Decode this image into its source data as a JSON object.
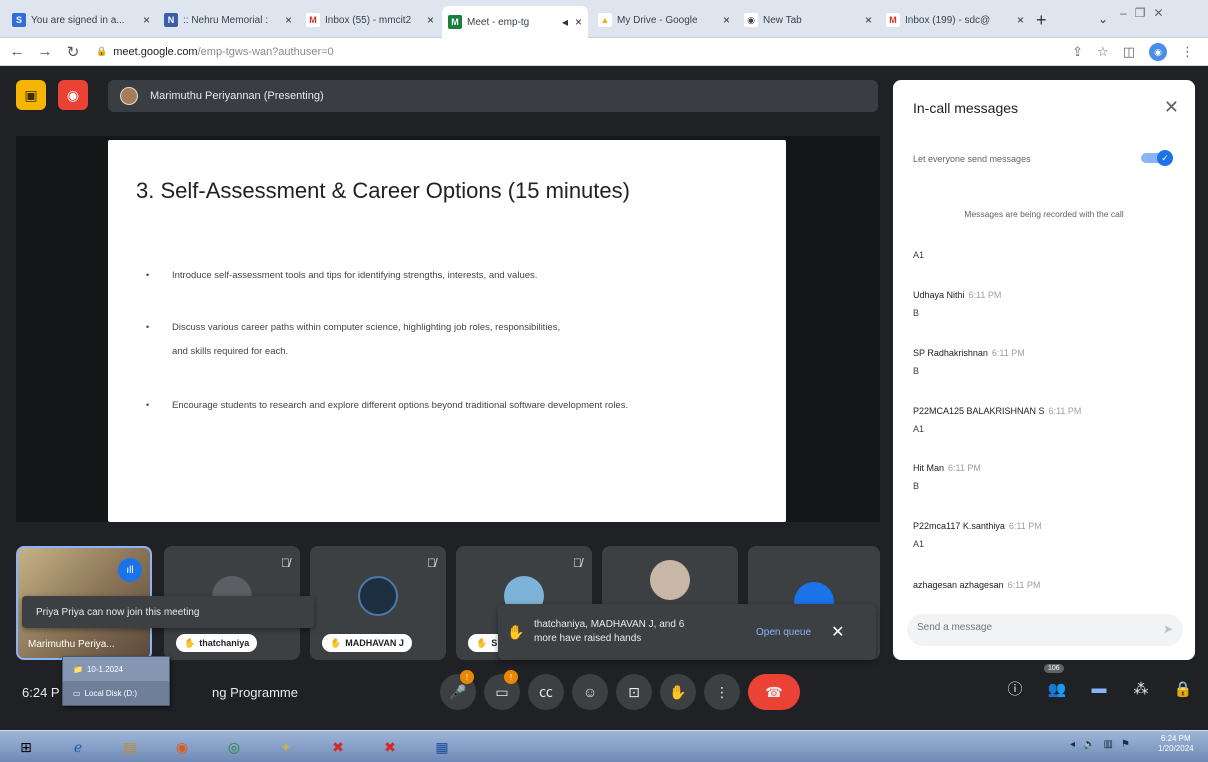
{
  "browser": {
    "tabs": [
      {
        "title": "You are signed in a...",
        "favicon": "S",
        "color": "#2f6fd6",
        "active": false
      },
      {
        "title": ":: Nehru Memorial :",
        "favicon": "N",
        "color": "#3b5ea8",
        "active": false
      },
      {
        "title": "Inbox (55) - mmcit2",
        "favicon": "M",
        "color": "#d93025",
        "active": false
      },
      {
        "title": "Meet - emp-tg",
        "favicon": "M",
        "color": "#188038",
        "active": true
      },
      {
        "title": "My Drive - Google",
        "favicon": "▲",
        "color": "#f2b400",
        "active": false
      },
      {
        "title": "New Tab",
        "favicon": "◉",
        "color": "#444444",
        "active": false
      },
      {
        "title": "Inbox (199) - sdc@",
        "favicon": "M",
        "color": "#d93025",
        "active": false
      }
    ],
    "new_tab": "+",
    "url_domain": "meet.google.com",
    "url_path": "/emp-tgws-wan?authuser=0"
  },
  "meet": {
    "presenter_label": "Marimuthu Periyannan (Presenting)",
    "slide": {
      "title": "3. Self-Assessment & Career Options (15 minutes)",
      "bullets": [
        "Introduce self-assessment tools and tips for identifying strengths, interests, and values.",
        "Discuss various career paths within computer science, highlighting job roles, responsibilities,",
        "and skills required for each.",
        "Encourage students to research and explore different options beyond traditional software development roles."
      ]
    },
    "tiles": [
      {
        "name": "Marimuthu Periya..."
      },
      {
        "name": "thatchaniya"
      },
      {
        "name": "MADHAVAN J"
      },
      {
        "name": "S"
      }
    ],
    "toast_join": "Priya Priya can now join this meeting",
    "toast_hands": {
      "line1": "thatchaniya, MADHAVAN J, and 6",
      "line2": "more have raised hands",
      "action": "Open queue"
    },
    "clock": "6:24 P",
    "title": "ng Programme",
    "participant_count": "106",
    "mic_badge": "!",
    "cam_badge": "!"
  },
  "panel": {
    "title": "In-call messages",
    "toggle_label": "Let everyone send messages",
    "recorded_note": "Messages are being recorded with the call",
    "first_message": "A1",
    "messages": [
      {
        "sender": "Udhaya Nithi",
        "time": "6:11 PM",
        "text": "B"
      },
      {
        "sender": "SP Radhakrishnan",
        "time": "6:11 PM",
        "text": "B"
      },
      {
        "sender": "P22MCA125 BALAKRISHNAN S",
        "time": "6:11 PM",
        "text": "A1"
      },
      {
        "sender": "Hit Man",
        "time": "6:11 PM",
        "text": "B"
      },
      {
        "sender": "P22mca117 K.santhiya",
        "time": "6:11 PM",
        "text": "A1"
      },
      {
        "sender": "azhagesan azhagesan",
        "time": "6:11 PM",
        "text": ""
      }
    ],
    "send_placeholder": "Send a message"
  },
  "os": {
    "popup": [
      "10-1.2024",
      "Local Disk (D:)"
    ],
    "tray_time": "6:24 PM",
    "tray_date": "1/20/2024"
  }
}
